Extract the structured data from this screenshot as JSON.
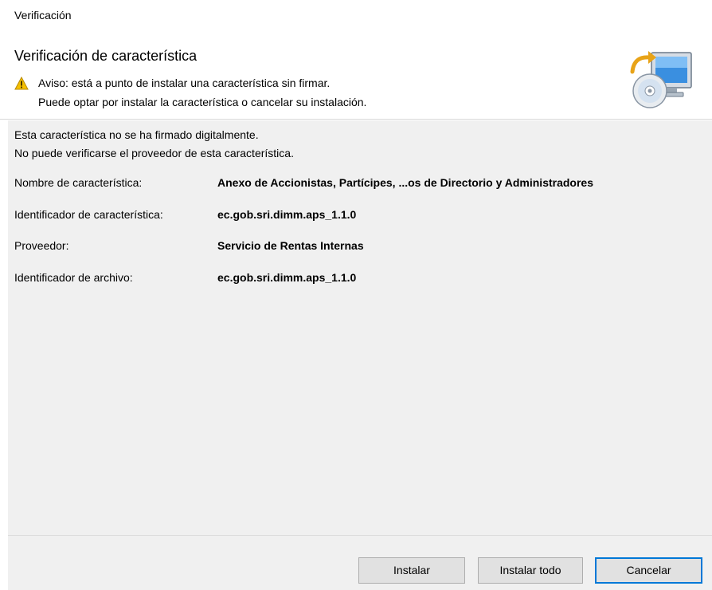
{
  "window": {
    "title": "Verificación"
  },
  "header": {
    "title": "Verificación de característica",
    "warning_line1": "Aviso: está a punto de instalar una característica sin firmar.",
    "warning_line2": "Puede optar por instalar la característica o cancelar su instalación.",
    "warning_icon": "warning-triangle-icon",
    "banner_icon": "install-cd-monitor-icon"
  },
  "body": {
    "description_line1": "Esta característica no se ha firmado digitalmente.",
    "description_line2": "No puede verificarse el proveedor de esta característica.",
    "details": [
      {
        "label": "Nombre de característica:",
        "value": "Anexo de Accionistas, Partícipes, ...os de Directorio y Administradores"
      },
      {
        "label": "Identificador de característica:",
        "value": "ec.gob.sri.dimm.aps_1.1.0"
      },
      {
        "label": "Proveedor:",
        "value": "Servicio de Rentas Internas"
      },
      {
        "label": "Identificador de archivo:",
        "value": "ec.gob.sri.dimm.aps_1.1.0"
      }
    ]
  },
  "buttons": {
    "install": "Instalar",
    "install_all": "Instalar todo",
    "cancel": "Cancelar"
  },
  "colors": {
    "accent": "#0078d7",
    "panel": "#f0f0f0",
    "button": "#e1e1e1"
  }
}
